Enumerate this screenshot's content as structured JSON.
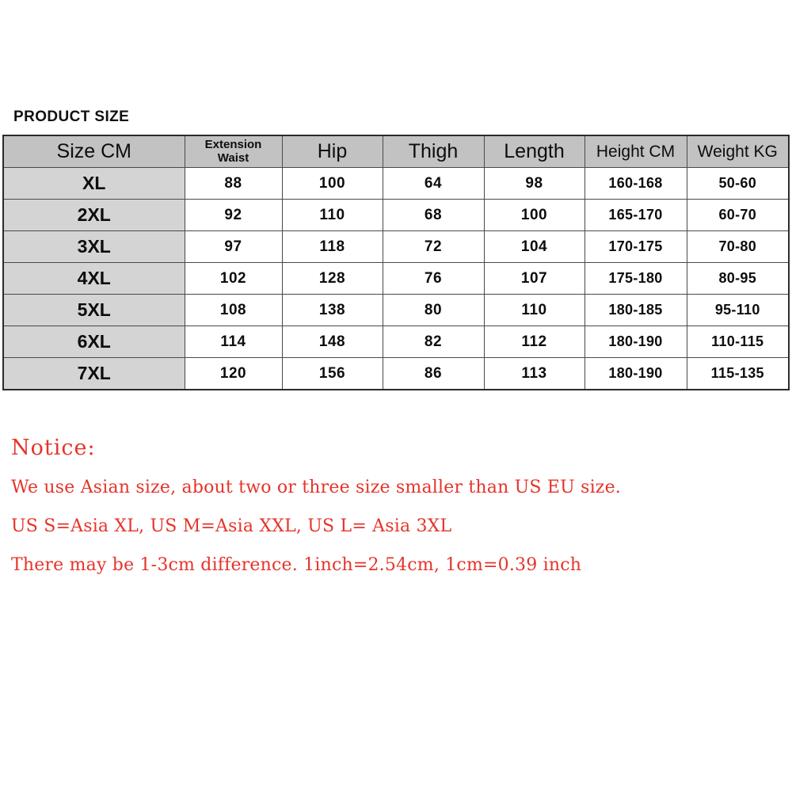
{
  "title": "PRODUCT SIZE",
  "table": {
    "headers": [
      {
        "label": "Size CM",
        "style": "h-size"
      },
      {
        "line1": "Extension",
        "line2": "Waist",
        "style": "h-two-line"
      },
      {
        "label": "Hip",
        "style": "h-big"
      },
      {
        "label": "Thigh",
        "style": "h-big"
      },
      {
        "label": "Length",
        "style": "h-big"
      },
      {
        "label": "Height CM",
        "style": "h-med"
      },
      {
        "label": "Weight KG",
        "style": "h-med"
      }
    ],
    "rows": [
      {
        "size": "XL",
        "extension_waist": "88",
        "hip": "100",
        "thigh": "64",
        "length": "98",
        "height_cm": "160-168",
        "weight_kg": "50-60"
      },
      {
        "size": "2XL",
        "extension_waist": "92",
        "hip": "110",
        "thigh": "68",
        "length": "100",
        "height_cm": "165-170",
        "weight_kg": "60-70"
      },
      {
        "size": "3XL",
        "extension_waist": "97",
        "hip": "118",
        "thigh": "72",
        "length": "104",
        "height_cm": "170-175",
        "weight_kg": "70-80"
      },
      {
        "size": "4XL",
        "extension_waist": "102",
        "hip": "128",
        "thigh": "76",
        "length": "107",
        "height_cm": "175-180",
        "weight_kg": "80-95"
      },
      {
        "size": "5XL",
        "extension_waist": "108",
        "hip": "138",
        "thigh": "80",
        "length": "110",
        "height_cm": "180-185",
        "weight_kg": "95-110"
      },
      {
        "size": "6XL",
        "extension_waist": "114",
        "hip": "148",
        "thigh": "82",
        "length": "112",
        "height_cm": "180-190",
        "weight_kg": "110-115"
      },
      {
        "size": "7XL",
        "extension_waist": "120",
        "hip": "156",
        "thigh": "86",
        "length": "113",
        "height_cm": "180-190",
        "weight_kg": "115-135"
      }
    ]
  },
  "notice": {
    "heading": "Notice:",
    "lines": [
      "We use Asian size, about two or three size smaller than US EU size.",
      "US S=Asia XL, US M=Asia XXL, US L= Asia 3XL",
      "There may be 1-3cm difference. 1inch=2.54cm, 1cm=0.39 inch"
    ]
  },
  "colors": {
    "notice_red": "#e5342a",
    "header_gray": "#c2c2c2",
    "size_cell_gray": "#d4d4d4",
    "border_dark": "#2b2b2b",
    "text_black": "#0d0d0d"
  }
}
